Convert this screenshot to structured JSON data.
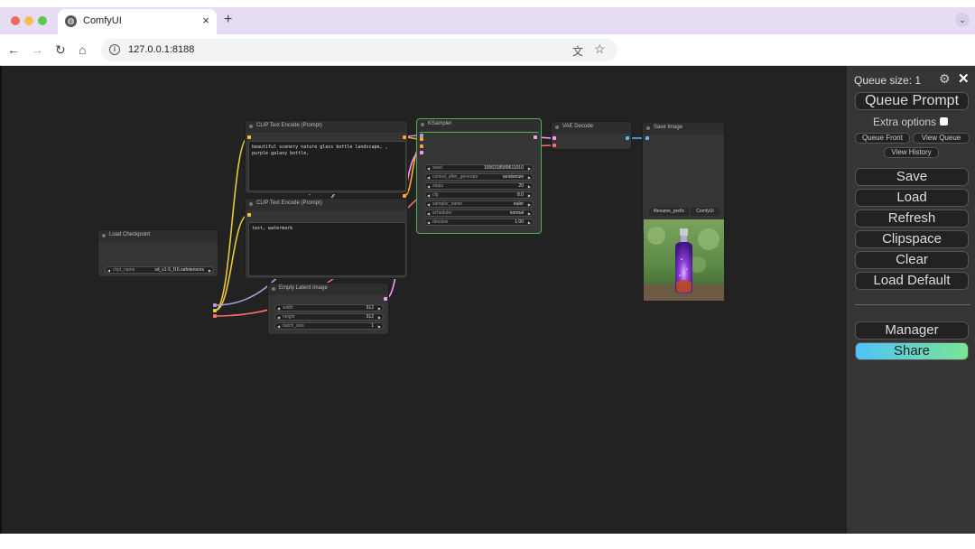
{
  "browser": {
    "tab_title": "ComfyUI",
    "tab_close": "×",
    "new_tab": "+",
    "menu": "⌄",
    "url": "127.0.0.1:8188",
    "info": "i",
    "back": "←",
    "forward": "→",
    "reload": "↻",
    "home": "⌂",
    "translate": "文",
    "star": "☆"
  },
  "nodes": {
    "clip1": {
      "title": "CLIP Text Encode (Prompt)",
      "text": "beautiful scenery nature glass bottle landscape, , purple galaxy bottle,"
    },
    "clip2": {
      "title": "CLIP Text Encode (Prompt)",
      "text": "text, watermark"
    },
    "ksampler": {
      "title": "KSampler",
      "widgets": [
        {
          "name": "seed",
          "value": "1056318589611010"
        },
        {
          "name": "control_after_generate",
          "value": "randomize"
        },
        {
          "name": "steps",
          "value": "20"
        },
        {
          "name": "cfg",
          "value": "8.0"
        },
        {
          "name": "sampler_name",
          "value": "euler"
        },
        {
          "name": "scheduler",
          "value": "normal"
        },
        {
          "name": "denoise",
          "value": "1.00"
        }
      ]
    },
    "vae": {
      "title": "VAE Decode"
    },
    "save": {
      "title": "Save Image",
      "tab_prefix": "filename_prefix",
      "tab_value": "ComfyUI"
    },
    "checkpoint": {
      "title": "Load Checkpoint",
      "widget": {
        "name": "ckpt_name",
        "value": "sd_v1-5_f16.safetensors"
      }
    },
    "latent": {
      "title": "Empty Latent Image",
      "widgets": [
        {
          "name": "width",
          "value": "512"
        },
        {
          "name": "height",
          "value": "512"
        },
        {
          "name": "batch_size",
          "value": "1"
        }
      ]
    }
  },
  "arrows": {
    "left": "◀",
    "right": "▶"
  },
  "panel": {
    "queue_size": "Queue size: 1",
    "gear": "⚙",
    "close": "✕",
    "queue_prompt": "Queue Prompt",
    "extra_options": "Extra options",
    "queue_front": "Queue Front",
    "view_queue": "View Queue",
    "view_history": "View History",
    "save": "Save",
    "load": "Load",
    "refresh": "Refresh",
    "clipspace": "Clipspace",
    "clear": "Clear",
    "load_default": "Load Default",
    "manager": "Manager",
    "share": "Share"
  },
  "colors": {
    "canvas": "#222222",
    "panel": "#353535",
    "link_clip": "#e7c93a",
    "link_model": "#b39ddb",
    "link_vae": "#ff6e6e",
    "link_conditioning": "#ffa931",
    "link_latent": "#ff9cf9",
    "link_image": "#64b5f6",
    "selected_node": "#4caf50"
  }
}
